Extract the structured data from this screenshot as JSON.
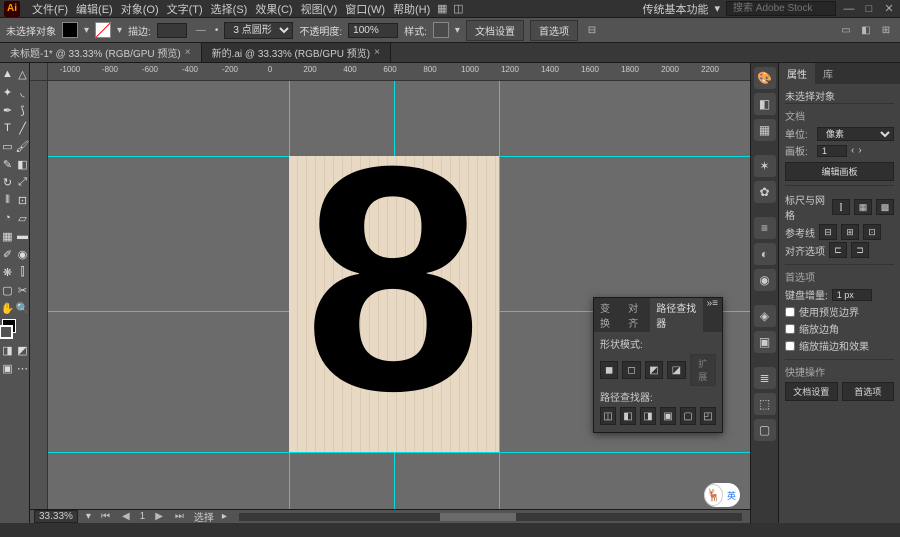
{
  "menubar": {
    "logo": "Ai",
    "items": [
      "文件(F)",
      "编辑(E)",
      "对象(O)",
      "文字(T)",
      "选择(S)",
      "效果(C)",
      "视图(V)",
      "窗口(W)",
      "帮助(H)"
    ],
    "right_label": "传统基本功能",
    "search_placeholder": "搜索 Adobe Stock"
  },
  "controlbar": {
    "no_selection": "未选择对象",
    "stroke_label": "描边:",
    "stroke_weight": "",
    "stroke_style": "3 点圆形",
    "opacity_label": "不透明度:",
    "opacity_value": "100%",
    "style_label": "样式:",
    "doc_setup": "文档设置",
    "prefs": "首选项"
  },
  "tabs": [
    {
      "label": "未标题-1* @ 33.33% (RGB/GPU 预览)",
      "active": true
    },
    {
      "label": "新的.ai @ 33.33% (RGB/GPU 预览)",
      "active": false
    }
  ],
  "ruler_ticks": [
    "-1000",
    "-800",
    "-600",
    "-400",
    "-200",
    "0",
    "200",
    "400",
    "600",
    "800",
    "1000",
    "1200",
    "1400",
    "1600",
    "1800",
    "2000",
    "2200"
  ],
  "right_panel": {
    "tabs": [
      "属性",
      "库"
    ],
    "no_selection": "未选择对象",
    "doc_section": "文档",
    "unit_label": "单位:",
    "unit_value": "像素",
    "artboard_label": "画板:",
    "artboard_value": "1",
    "edit_artboard": "编辑画板",
    "ruler_grid": "标尺与网格",
    "guides": "参考线",
    "align_opts": "对齐选项",
    "prefs_section": "首选项",
    "key_inc_label": "键盘增量:",
    "key_inc_value": "1 px",
    "chk1": "使用预览边界",
    "chk2": "缩放边角",
    "chk3": "缩放描边和效果",
    "quick_actions": "快捷操作",
    "doc_setup_btn": "文档设置",
    "prefs_btn": "首选项"
  },
  "pathfinder": {
    "tabs": [
      "变换",
      "对齐",
      "路径查找器"
    ],
    "shape_modes": "形状模式:",
    "expand": "扩展",
    "pathfinder_label": "路径查找器:"
  },
  "statusbar": {
    "zoom": "33.33%",
    "nav_label": "选择"
  },
  "badge_text": "英"
}
